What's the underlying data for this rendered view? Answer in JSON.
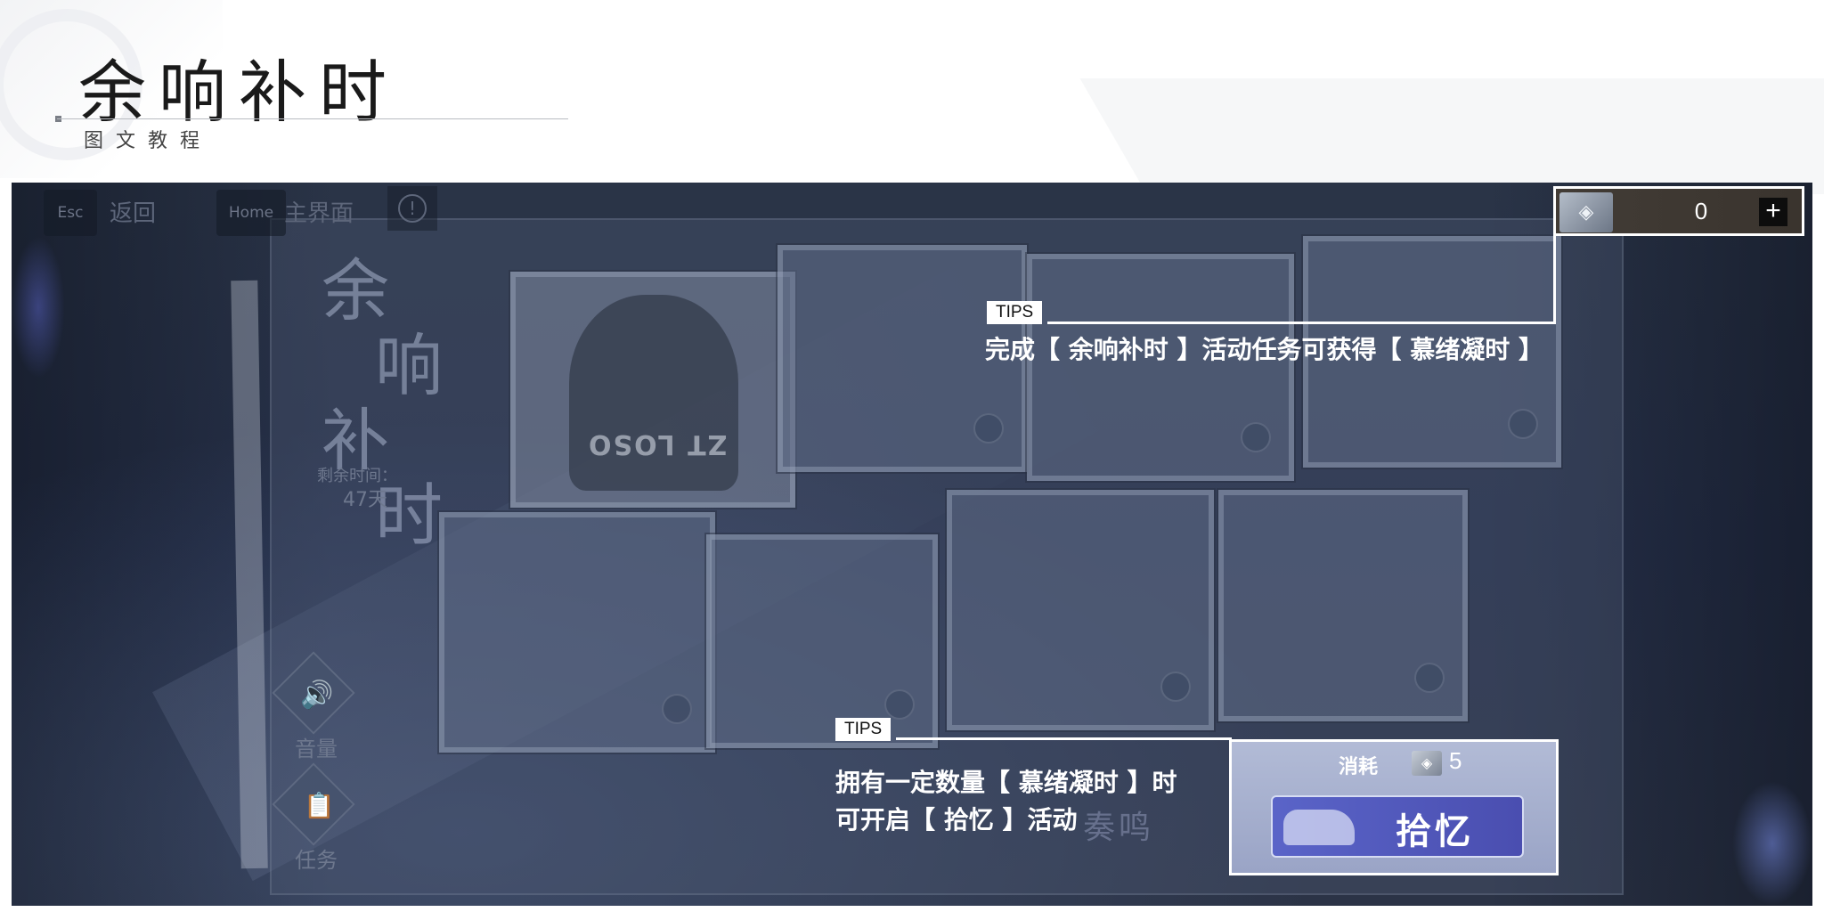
{
  "header": {
    "title": "余响补时",
    "subtitle": "图文教程"
  },
  "game_ui": {
    "esc_key": "Esc",
    "back_label": "返回",
    "home_key": "Home",
    "main_label": "主界面",
    "info_icon": "info-icon",
    "event_logo_lines": [
      "余",
      "响",
      "补",
      "时"
    ],
    "remaining_time_label": "剩余时间：",
    "remaining_time_value": "47天",
    "volume_label": "音量",
    "task_label": "任务",
    "card_code_text": "ZT LOSO",
    "background_text": "奏鸣",
    "currency": {
      "icon": "memory-token-icon",
      "value": "0",
      "plus": "+"
    },
    "recall": {
      "cost_label": "消耗",
      "cost_icon": "memory-token-icon",
      "cost_value": "5",
      "button_label": "拾忆",
      "button_icon": "piano-icon"
    }
  },
  "tips": [
    {
      "tag": "TIPS",
      "lines": [
        "完成【 余响补时 】活动任务可获得【 慕绪凝时 】"
      ]
    },
    {
      "tag": "TIPS",
      "lines": [
        "拥有一定数量【 慕绪凝时 】时",
        "可开启【 拾忆 】活动"
      ]
    }
  ],
  "colors": {
    "overlay": "#26304a",
    "accent_white": "#ffffff",
    "recall_button": "#5a64c8"
  }
}
